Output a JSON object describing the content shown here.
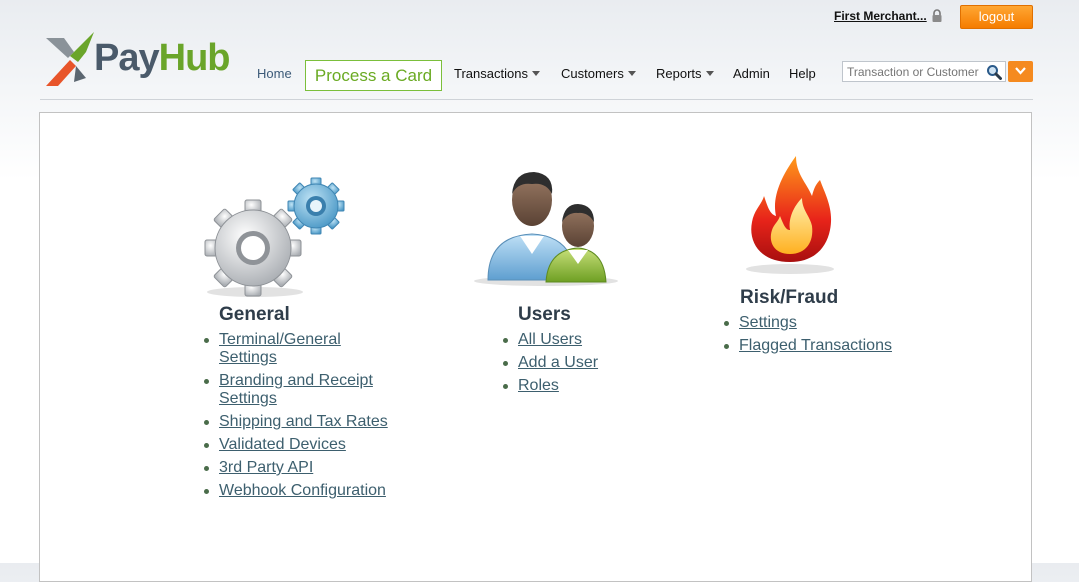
{
  "header": {
    "merchant_name": "First Merchant...",
    "logout_label": "logout",
    "logo_part1": "Pay",
    "logo_part2": "Hub"
  },
  "nav": {
    "home": "Home",
    "process_card": "Process a Card",
    "transactions": "Transactions",
    "customers": "Customers",
    "reports": "Reports",
    "admin": "Admin",
    "help": "Help"
  },
  "search": {
    "placeholder": "Transaction or Customer"
  },
  "sections": {
    "general": {
      "title": "General",
      "links": [
        "Terminal/General Settings",
        "Branding and Receipt Settings",
        "Shipping and Tax Rates",
        "Validated Devices",
        "3rd Party API",
        "Webhook Configuration"
      ]
    },
    "users": {
      "title": "Users",
      "links": [
        "All Users",
        "Add a User",
        "Roles"
      ]
    },
    "risk": {
      "title": "Risk/Fraud",
      "links": [
        "Settings",
        "Flagged Transactions"
      ]
    }
  },
  "colors": {
    "brand_green": "#6aa52a",
    "logout_orange": "#f57c00",
    "link": "#3d5f6e"
  },
  "icons": [
    "lock-icon",
    "search-icon",
    "chevron-down-icon",
    "gears-icon",
    "users-icon",
    "fire-icon"
  ]
}
